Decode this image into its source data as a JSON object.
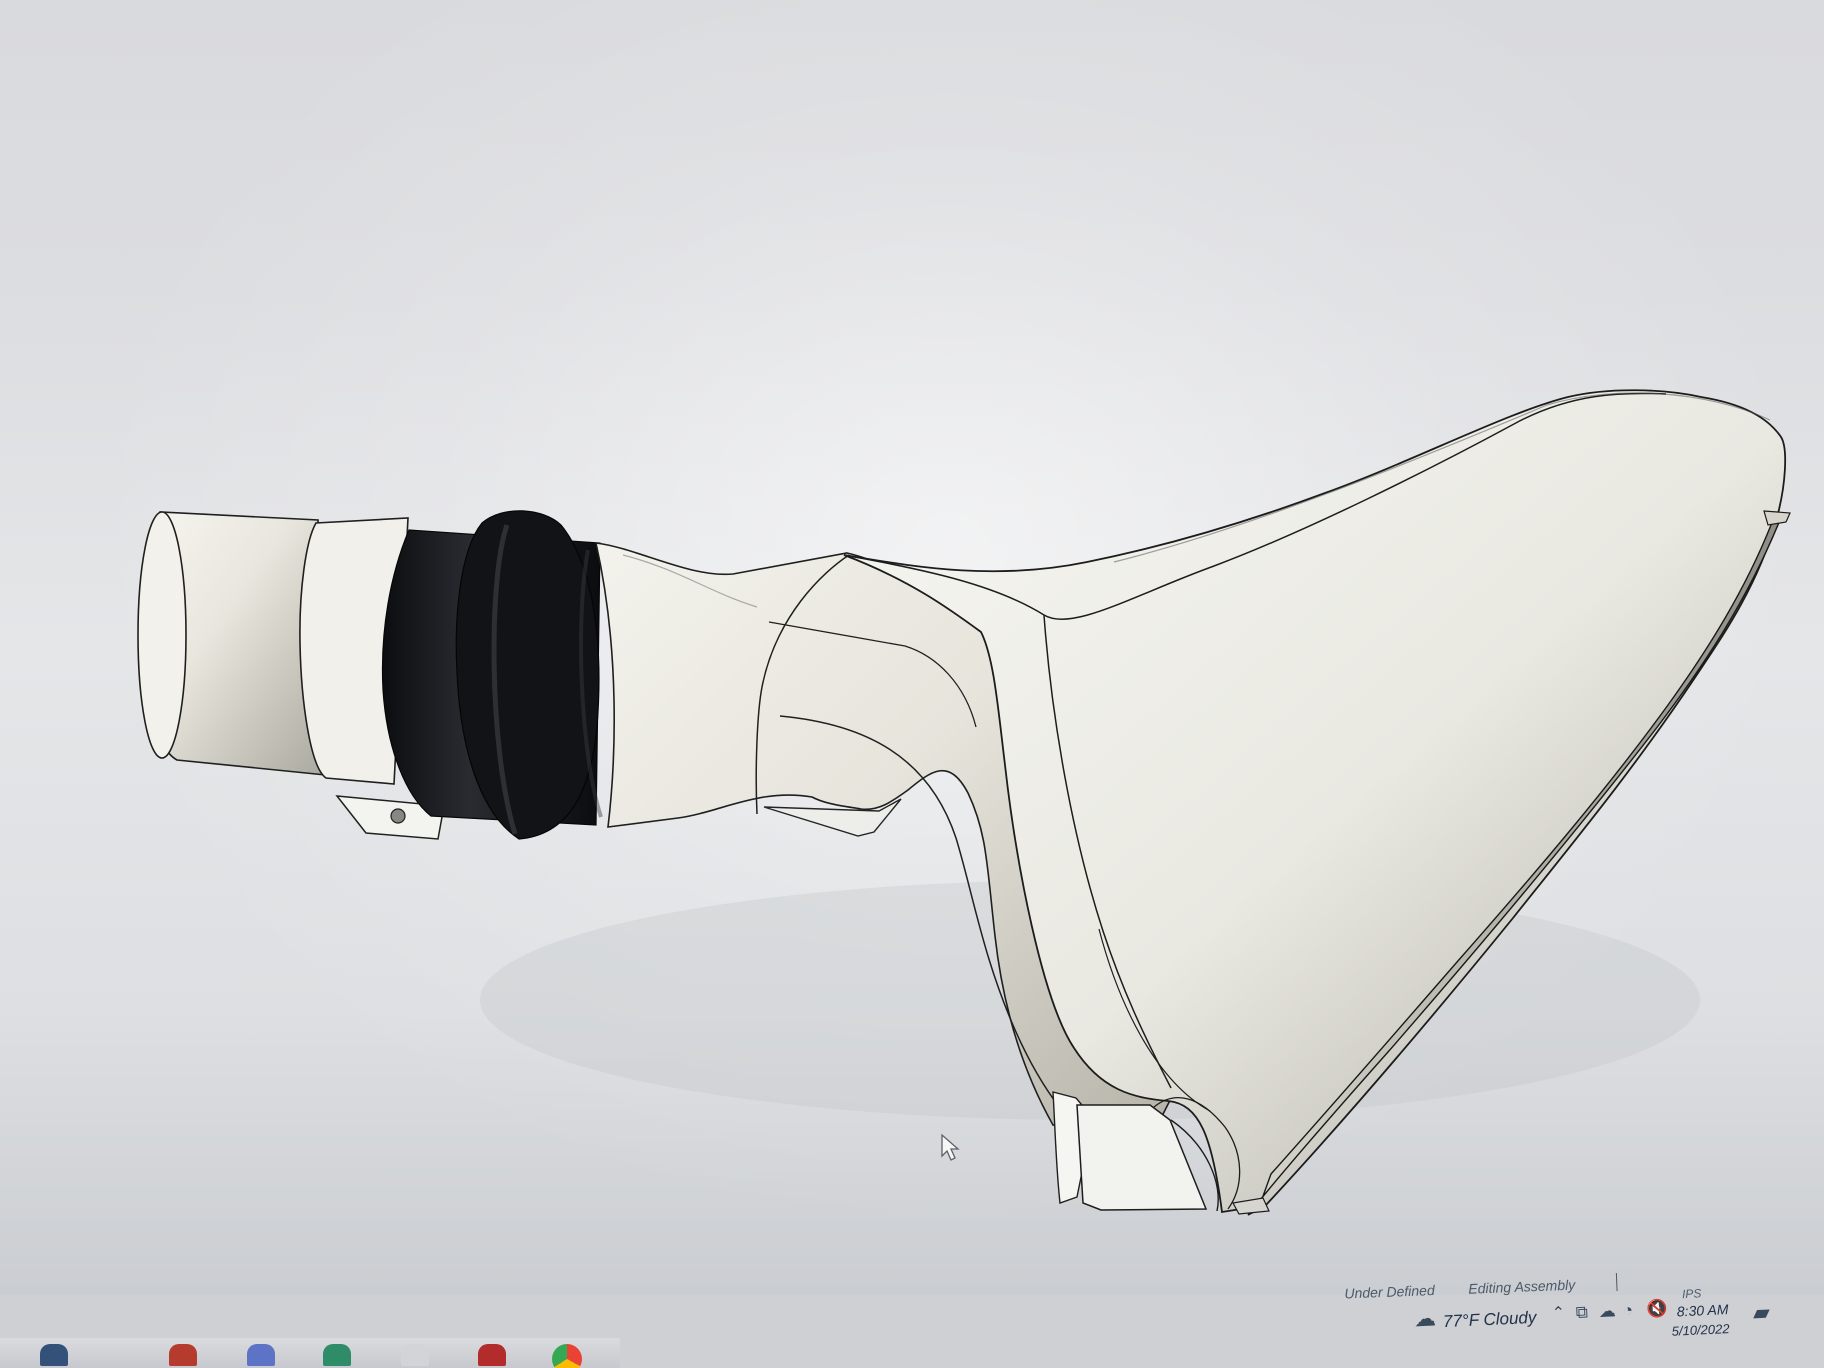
{
  "viewport": {
    "background": "#dddee1",
    "model_colors": {
      "body": "#efefea",
      "shadow": "#b8b7ae",
      "rubber": "#111216",
      "edge": "#1c1c1c"
    }
  },
  "status_bar": {
    "under_defined": "Under Defined",
    "editing": "Editing Assembly"
  },
  "tray": {
    "ime": "IPS",
    "weather": "77°F  Cloudy",
    "time": "8:30 AM",
    "date": "5/10/2022",
    "icons": [
      "cloud-icon",
      "chevron-up-icon",
      "network-icon",
      "onedrive-icon",
      "wifi-icon",
      "volume-muted-icon",
      "notification-icon"
    ]
  },
  "taskbar": {
    "apps": [
      {
        "name": "taskbar-app-1",
        "color": "#34517a"
      },
      {
        "name": "taskbar-app-2",
        "color": "#b53b2e"
      },
      {
        "name": "taskbar-app-3",
        "color": "#5d73c6"
      },
      {
        "name": "taskbar-app-4",
        "color": "#2e8c68"
      },
      {
        "name": "taskbar-app-5",
        "color": "#d3d4d8"
      },
      {
        "name": "solidworks-icon",
        "color": "#b22c2b"
      },
      {
        "name": "chrome-icon",
        "color": "#4f89ff"
      }
    ]
  }
}
